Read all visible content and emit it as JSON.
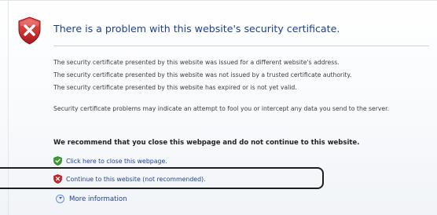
{
  "header": {
    "title": "There is a problem with this website's security certificate."
  },
  "messages": [
    "The security certificate presented by this website was issued for a different website's address.",
    "The security certificate presented by this website was not issued by a trusted certificate authority.",
    "The security certificate presented by this website has expired or is not yet valid."
  ],
  "warning": "Security certificate problems may indicate an attempt to fool you or intercept any data you send to the server.",
  "recommendation": "We recommend that you close this webpage and do not continue to this website.",
  "links": {
    "close": "Click here to close this webpage.",
    "continue": "Continue to this website (not recommended)."
  },
  "more_info": "More information",
  "icons": {
    "header": "security-shield-error-icon",
    "close": "green-shield-icon",
    "continue": "red-shield-icon",
    "more_info": "expand-chevron-icon"
  },
  "colors": {
    "title": "#1c3f94",
    "link": "#1c3f94",
    "shield_red": "#c8262b",
    "shield_green": "#3c9a2e"
  }
}
